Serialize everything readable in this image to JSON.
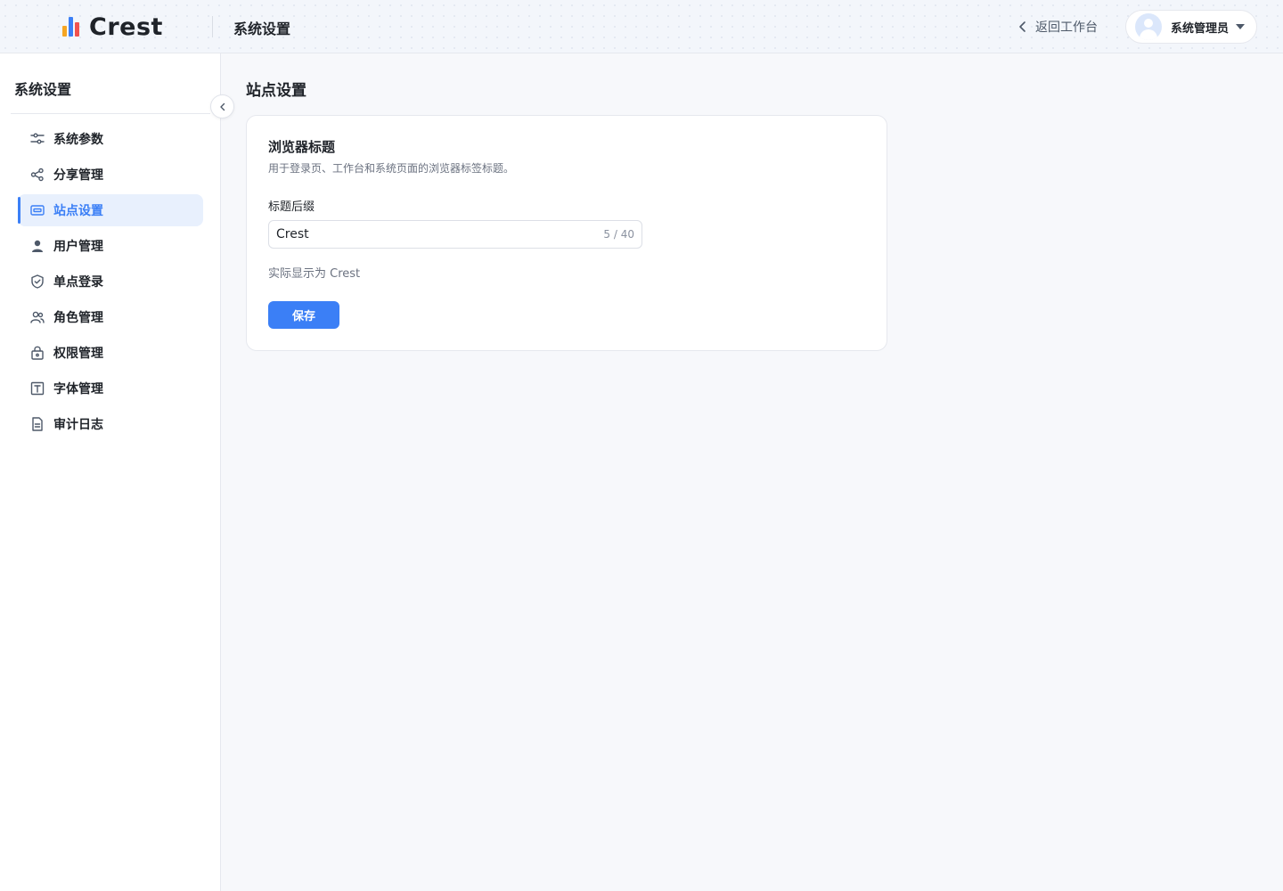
{
  "header": {
    "logo_text": "Crest",
    "title": "系统设置",
    "back_label": "返回工作台",
    "user_name": "系统管理员"
  },
  "sidebar": {
    "title": "系统设置",
    "items": [
      {
        "label": "系统参数",
        "icon": "sliders-icon",
        "active": false
      },
      {
        "label": "分享管理",
        "icon": "share-icon",
        "active": false
      },
      {
        "label": "站点设置",
        "icon": "site-card-icon",
        "active": true
      },
      {
        "label": "用户管理",
        "icon": "user-icon",
        "active": false
      },
      {
        "label": "单点登录",
        "icon": "shield-check-icon",
        "active": false
      },
      {
        "label": "角色管理",
        "icon": "users-icon",
        "active": false
      },
      {
        "label": "权限管理",
        "icon": "lock-bag-icon",
        "active": false
      },
      {
        "label": "字体管理",
        "icon": "text-box-icon",
        "active": false
      },
      {
        "label": "审计日志",
        "icon": "document-icon",
        "active": false
      }
    ]
  },
  "main": {
    "title": "站点设置",
    "card": {
      "title": "浏览器标题",
      "description": "用于登录页、工作台和系统页面的浏览器标签标题。",
      "field_label": "标题后缀",
      "input_value": "Crest",
      "counter": "5 / 40",
      "hint": "实际显示为 Crest",
      "save_label": "保存"
    }
  },
  "colors": {
    "accent": "#3b7ff6",
    "active_bg": "#e8f0fd",
    "text": "#1f2329",
    "muted": "#6b7280"
  }
}
